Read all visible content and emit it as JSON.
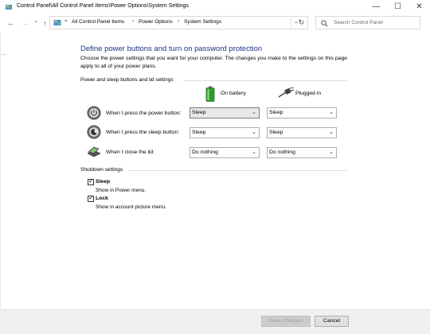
{
  "window": {
    "title": "Control Panel\\All Control Panel Items\\Power Options\\System Settings",
    "controls": {
      "minimize": "—",
      "maximize": "☐",
      "close": "✕"
    }
  },
  "nav": {
    "back": "←",
    "forward": "→",
    "recent": "⌄",
    "up": "↑",
    "breadcrumb_prefix": "«",
    "breadcrumbs": [
      "All Control Panel Items",
      "Power Options",
      "System Settings"
    ],
    "separator": "›",
    "dropdown": "⌄",
    "refresh": "↻"
  },
  "search": {
    "placeholder": "Search Control Panel",
    "icon": "search-icon"
  },
  "page": {
    "heading": "Define power buttons and turn on password protection",
    "description": "Choose the power settings that you want for your computer. The changes you make to the settings on this page apply to all of your power plans."
  },
  "power_section": {
    "title": "Power and sleep buttons and lid settings",
    "columns": {
      "battery": "On battery",
      "plugged": "Plugged in"
    },
    "rows": [
      {
        "label": "When I press the power button:",
        "battery": "Sleep",
        "plugged": "Sleep"
      },
      {
        "label": "When I press the sleep button:",
        "battery": "Sleep",
        "plugged": "Sleep"
      },
      {
        "label": "When I close the lid:",
        "battery": "Do nothing",
        "plugged": "Do nothing"
      }
    ]
  },
  "shutdown_section": {
    "title": "Shutdown settings",
    "items": [
      {
        "label": "Sleep",
        "description": "Show in Power menu.",
        "checked": true
      },
      {
        "label": "Lock",
        "description": "Show in account picture menu.",
        "checked": true
      }
    ]
  },
  "buttons": {
    "save": "Save changes",
    "cancel": "Cancel"
  },
  "glyphs": {
    "check": "✓",
    "dropdown": "⌄"
  }
}
